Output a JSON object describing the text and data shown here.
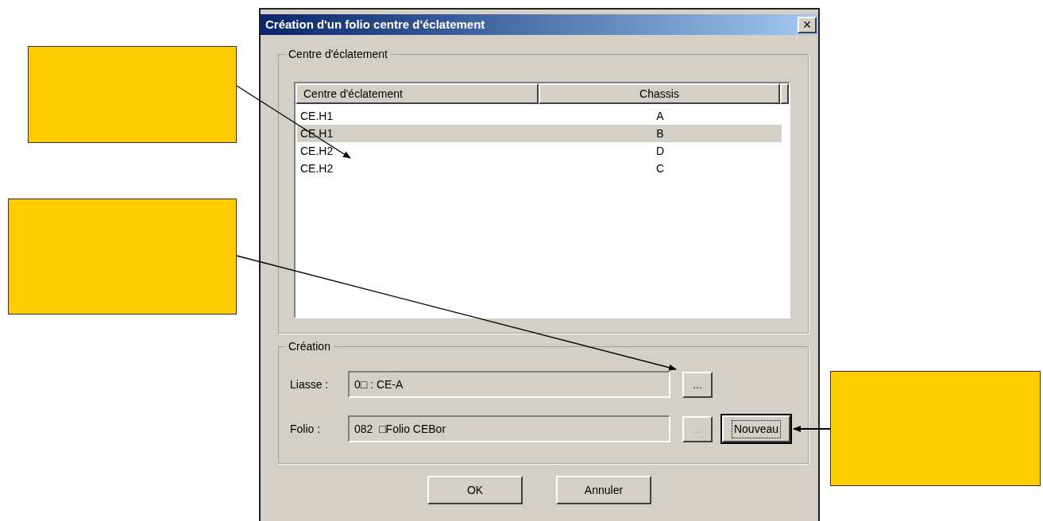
{
  "dialog": {
    "title": "Création d'un folio centre d'éclatement",
    "close": "×",
    "explode_group": {
      "label": "Centre d'éclatement",
      "columns": [
        "Centre d'éclatement",
        "Chassis"
      ],
      "rows": [
        {
          "cells": [
            "CE.H1",
            "A"
          ],
          "selected": false
        },
        {
          "cells": [
            "CE.H1",
            "B"
          ],
          "selected": true
        },
        {
          "cells": [
            "CE.H2",
            "D"
          ],
          "selected": false
        },
        {
          "cells": [
            "CE.H2",
            "C"
          ],
          "selected": false
        }
      ]
    },
    "creation_group": {
      "label": "Création",
      "fields": [
        {
          "label": "Liasse :",
          "value": "0□ : CE-A",
          "browse": {
            "label": "...",
            "disabled": false
          }
        },
        {
          "label": "Folio :",
          "value": "082  □Folio CEBor",
          "browse": {
            "label": "...",
            "disabled": true
          }
        }
      ],
      "new_button": {
        "label": "Nouveau",
        "focused": true
      }
    },
    "buttons": [
      "OK",
      "Annuler"
    ]
  }
}
